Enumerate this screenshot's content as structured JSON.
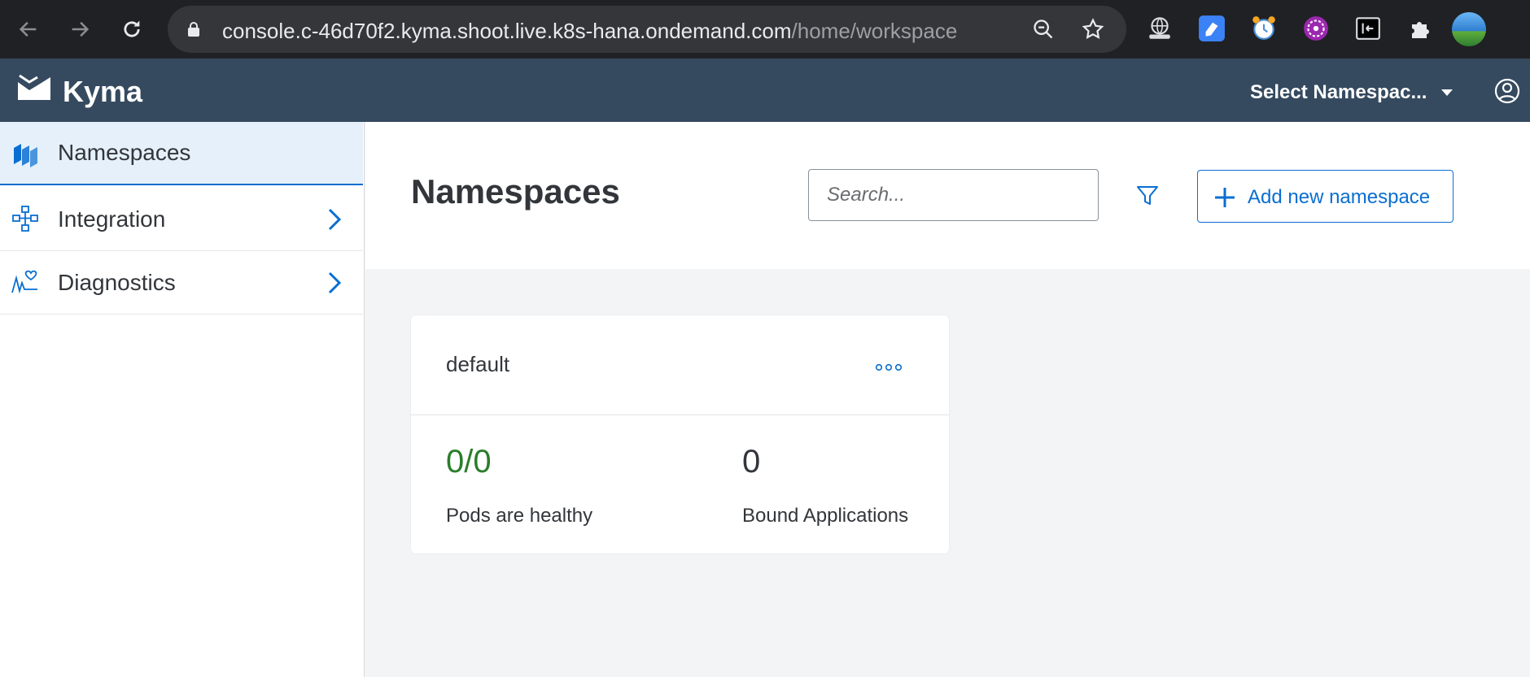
{
  "browser": {
    "url_host": "console.c-46d70f2.kyma.shoot.live.k8s-hana.ondemand.com",
    "url_path": "/home/workspace",
    "extensions": [
      "globe-hand-icon",
      "blue-tag-icon",
      "alarm-clock-icon",
      "purple-circle-icon",
      "sidebar-toggle-icon",
      "puzzle-icon",
      "profile-avatar-icon"
    ]
  },
  "shellbar": {
    "brand": "Kyma",
    "namespace_select": "Select Namespac...",
    "colors": {
      "background": "#354a5f"
    }
  },
  "sidebar": {
    "items": [
      {
        "label": "Namespaces",
        "icon": "namespaces-icon",
        "active": true
      },
      {
        "label": "Integration",
        "icon": "integration-icon",
        "active": false
      },
      {
        "label": "Diagnostics",
        "icon": "diagnostics-icon",
        "active": false
      }
    ]
  },
  "header": {
    "title": "Namespaces",
    "search_placeholder": "Search...",
    "add_button_label": "Add new namespace"
  },
  "namespace_card": {
    "name": "default",
    "pods_value": "0/0",
    "pods_label": "Pods are healthy",
    "apps_value": "0",
    "apps_label": "Bound Applications",
    "colors": {
      "pods_value": "#2b7d2b",
      "accent": "#0a6ed1"
    }
  }
}
